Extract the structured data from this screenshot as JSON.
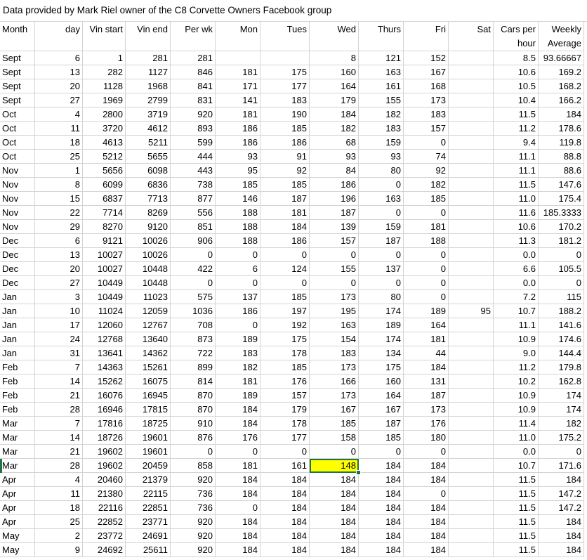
{
  "title": "Data provided by Mark Riel owner of the C8 Corvette Owners Facebook group",
  "headers": {
    "month": "Month",
    "day": "day",
    "vin_start": "Vin start",
    "vin_end": "Vin end",
    "per_wk": "Per wk",
    "mon": "Mon",
    "tues": "Tues",
    "wed": "Wed",
    "thurs": "Thurs",
    "fri": "Fri",
    "sat": "Sat",
    "cars_per_hour_1": "Cars per",
    "cars_per_hour_2": "hour",
    "weekly_average_1": "Weekly",
    "weekly_average_2": "Average"
  },
  "selected_cell": {
    "row": 29,
    "col": "wed"
  },
  "rows": [
    [
      "Sept",
      "6",
      "1",
      "281",
      "281",
      "",
      "",
      "8",
      "121",
      "152",
      "",
      "8.5",
      "93.66667"
    ],
    [
      "Sept",
      "13",
      "282",
      "1127",
      "846",
      "181",
      "175",
      "160",
      "163",
      "167",
      "",
      "10.6",
      "169.2"
    ],
    [
      "Sept",
      "20",
      "1128",
      "1968",
      "841",
      "171",
      "177",
      "164",
      "161",
      "168",
      "",
      "10.5",
      "168.2"
    ],
    [
      "Sept",
      "27",
      "1969",
      "2799",
      "831",
      "141",
      "183",
      "179",
      "155",
      "173",
      "",
      "10.4",
      "166.2"
    ],
    [
      "Oct",
      "4",
      "2800",
      "3719",
      "920",
      "181",
      "190",
      "184",
      "182",
      "183",
      "",
      "11.5",
      "184"
    ],
    [
      "Oct",
      "11",
      "3720",
      "4612",
      "893",
      "186",
      "185",
      "182",
      "183",
      "157",
      "",
      "11.2",
      "178.6"
    ],
    [
      "Oct",
      "18",
      "4613",
      "5211",
      "599",
      "186",
      "186",
      "68",
      "159",
      "0",
      "",
      "9.4",
      "119.8"
    ],
    [
      "Oct",
      "25",
      "5212",
      "5655",
      "444",
      "93",
      "91",
      "93",
      "93",
      "74",
      "",
      "11.1",
      "88.8"
    ],
    [
      "Nov",
      "1",
      "5656",
      "6098",
      "443",
      "95",
      "92",
      "84",
      "80",
      "92",
      "",
      "11.1",
      "88.6"
    ],
    [
      "Nov",
      "8",
      "6099",
      "6836",
      "738",
      "185",
      "185",
      "186",
      "0",
      "182",
      "",
      "11.5",
      "147.6"
    ],
    [
      "Nov",
      "15",
      "6837",
      "7713",
      "877",
      "146",
      "187",
      "196",
      "163",
      "185",
      "",
      "11.0",
      "175.4"
    ],
    [
      "Nov",
      "22",
      "7714",
      "8269",
      "556",
      "188",
      "181",
      "187",
      "0",
      "0",
      "",
      "11.6",
      "185.3333"
    ],
    [
      "Nov",
      "29",
      "8270",
      "9120",
      "851",
      "188",
      "184",
      "139",
      "159",
      "181",
      "",
      "10.6",
      "170.2"
    ],
    [
      "Dec",
      "6",
      "9121",
      "10026",
      "906",
      "188",
      "186",
      "157",
      "187",
      "188",
      "",
      "11.3",
      "181.2"
    ],
    [
      "Dec",
      "13",
      "10027",
      "10026",
      "0",
      "0",
      "0",
      "0",
      "0",
      "0",
      "",
      "0.0",
      "0"
    ],
    [
      "Dec",
      "20",
      "10027",
      "10448",
      "422",
      "6",
      "124",
      "155",
      "137",
      "0",
      "",
      "6.6",
      "105.5"
    ],
    [
      "Dec",
      "27",
      "10449",
      "10448",
      "0",
      "0",
      "0",
      "0",
      "0",
      "0",
      "",
      "0.0",
      "0"
    ],
    [
      "Jan",
      "3",
      "10449",
      "11023",
      "575",
      "137",
      "185",
      "173",
      "80",
      "0",
      "",
      "7.2",
      "115"
    ],
    [
      "Jan",
      "10",
      "11024",
      "12059",
      "1036",
      "186",
      "197",
      "195",
      "174",
      "189",
      "95",
      "10.7",
      "188.2"
    ],
    [
      "Jan",
      "17",
      "12060",
      "12767",
      "708",
      "0",
      "192",
      "163",
      "189",
      "164",
      "",
      "11.1",
      "141.6"
    ],
    [
      "Jan",
      "24",
      "12768",
      "13640",
      "873",
      "189",
      "175",
      "154",
      "174",
      "181",
      "",
      "10.9",
      "174.6"
    ],
    [
      "Jan",
      "31",
      "13641",
      "14362",
      "722",
      "183",
      "178",
      "183",
      "134",
      "44",
      "",
      "9.0",
      "144.4"
    ],
    [
      "Feb",
      "7",
      "14363",
      "15261",
      "899",
      "182",
      "185",
      "173",
      "175",
      "184",
      "",
      "11.2",
      "179.8"
    ],
    [
      "Feb",
      "14",
      "15262",
      "16075",
      "814",
      "181",
      "176",
      "166",
      "160",
      "131",
      "",
      "10.2",
      "162.8"
    ],
    [
      "Feb",
      "21",
      "16076",
      "16945",
      "870",
      "189",
      "157",
      "173",
      "164",
      "187",
      "",
      "10.9",
      "174"
    ],
    [
      "Feb",
      "28",
      "16946",
      "17815",
      "870",
      "184",
      "179",
      "167",
      "167",
      "173",
      "",
      "10.9",
      "174"
    ],
    [
      "Mar",
      "7",
      "17816",
      "18725",
      "910",
      "184",
      "178",
      "185",
      "187",
      "176",
      "",
      "11.4",
      "182"
    ],
    [
      "Mar",
      "14",
      "18726",
      "19601",
      "876",
      "176",
      "177",
      "158",
      "185",
      "180",
      "",
      "11.0",
      "175.2"
    ],
    [
      "Mar",
      "21",
      "19602",
      "19601",
      "0",
      "0",
      "0",
      "0",
      "0",
      "0",
      "",
      "0.0",
      "0"
    ],
    [
      "Mar",
      "28",
      "19602",
      "20459",
      "858",
      "181",
      "161",
      "148",
      "184",
      "184",
      "",
      "10.7",
      "171.6"
    ],
    [
      "Apr",
      "4",
      "20460",
      "21379",
      "920",
      "184",
      "184",
      "184",
      "184",
      "184",
      "",
      "11.5",
      "184"
    ],
    [
      "Apr",
      "11",
      "21380",
      "22115",
      "736",
      "184",
      "184",
      "184",
      "184",
      "0",
      "",
      "11.5",
      "147.2"
    ],
    [
      "Apr",
      "18",
      "22116",
      "22851",
      "736",
      "0",
      "184",
      "184",
      "184",
      "184",
      "",
      "11.5",
      "147.2"
    ],
    [
      "Apr",
      "25",
      "22852",
      "23771",
      "920",
      "184",
      "184",
      "184",
      "184",
      "184",
      "",
      "11.5",
      "184"
    ],
    [
      "May",
      "2",
      "23772",
      "24691",
      "920",
      "184",
      "184",
      "184",
      "184",
      "184",
      "",
      "11.5",
      "184"
    ],
    [
      "May",
      "9",
      "24692",
      "25611",
      "920",
      "184",
      "184",
      "184",
      "184",
      "184",
      "",
      "11.5",
      "184"
    ]
  ]
}
